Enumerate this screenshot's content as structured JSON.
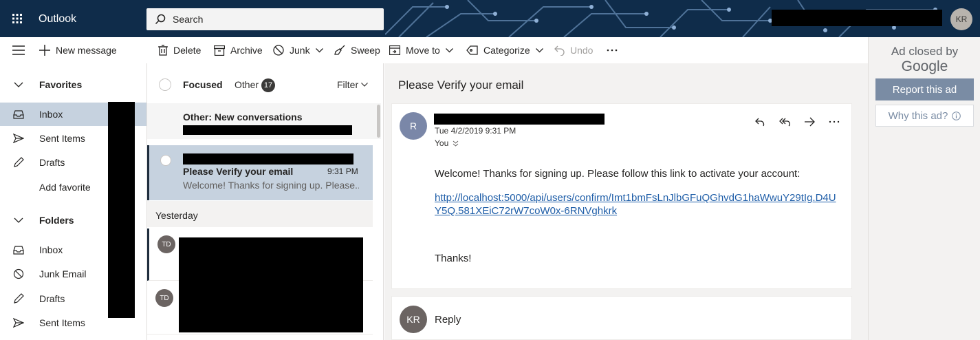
{
  "app": {
    "name": "Outlook"
  },
  "search": {
    "label": "Search"
  },
  "user": {
    "initials": "KR"
  },
  "toolbar": {
    "new_message": "New message",
    "delete": "Delete",
    "archive": "Archive",
    "junk": "Junk",
    "sweep": "Sweep",
    "move_to": "Move to",
    "categorize": "Categorize",
    "undo": "Undo"
  },
  "sidebar": {
    "favorites_label": "Favorites",
    "favorites": [
      {
        "label": "Inbox",
        "icon": "inbox-icon"
      },
      {
        "label": "Sent Items",
        "icon": "send-icon"
      },
      {
        "label": "Drafts",
        "icon": "pencil-icon"
      },
      {
        "label": "Add favorite"
      }
    ],
    "folders_label": "Folders",
    "folders": [
      {
        "label": "Inbox",
        "icon": "inbox-icon"
      },
      {
        "label": "Junk Email",
        "icon": "block-icon"
      },
      {
        "label": "Drafts",
        "icon": "pencil-icon"
      },
      {
        "label": "Sent Items",
        "icon": "send-icon"
      }
    ]
  },
  "message_list": {
    "tab_focused": "Focused",
    "tab_other": "Other",
    "other_count": "17",
    "filter": "Filter",
    "other_new": "Other: New conversations",
    "selected": {
      "subject": "Please Verify your email",
      "time": "9:31 PM",
      "preview": "Welcome! Thanks for signing up. Please..."
    },
    "group_yesterday": "Yesterday",
    "rows": [
      {
        "initials": "TD"
      },
      {
        "initials": "TD"
      }
    ]
  },
  "reading_pane": {
    "subject": "Please Verify your email",
    "sender_initial": "R",
    "date": "Tue 4/2/2019 9:31 PM",
    "to": "You",
    "body": "Welcome! Thanks for signing up. Please follow this link to activate your account:",
    "link": "http://localhost:5000/api/users/confirm/Imt1bmFsLnJlbGFuQGhvdG1haWwuY29tIg.D4UY5Q.581XEiC72rW7coW0x-6RNVghkrk",
    "closing": "Thanks!",
    "reply_initials": "KR",
    "reply_label": "Reply"
  },
  "ad": {
    "closed_by": "Ad closed by",
    "google": "Google",
    "report": "Report this ad",
    "why": "Why this ad?"
  },
  "colors": {
    "topbar": "#0f2c4a",
    "selected": "#c6d2df",
    "link": "#1f5ea8",
    "ad_button": "#7a8ca4"
  }
}
